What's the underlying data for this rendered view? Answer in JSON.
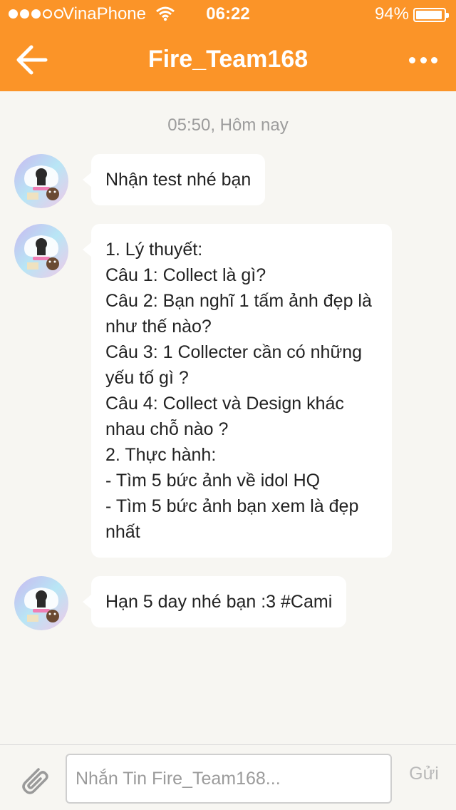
{
  "status_bar": {
    "signal_bars_filled": 3,
    "signal_bars_total": 5,
    "carrier": "VinaPhone",
    "time": "06:22",
    "battery_percent_label": "94%",
    "battery_level": 0.94
  },
  "header": {
    "title": "Fire_Team168",
    "back_icon": "arrow-left-icon",
    "more_icon": "more-dots-icon",
    "color": "#fb9428"
  },
  "chat": {
    "timestamp": "05:50, Hôm nay",
    "messages": [
      {
        "text": "Nhận test nhé bạn"
      },
      {
        "text": "1. Lý thuyết:\nCâu 1: Collect là gì?\nCâu 2: Bạn nghĩ 1 tấm ảnh đẹp là\nnhư thế nào?\nCâu 3: 1 Collecter cần có những\nyếu tố gì ?\nCâu 4: Collect và Design khác\nnhau chỗ nào ?\n2. Thực hành:\n- Tìm 5 bức ảnh về idol HQ\n- Tìm 5 bức ảnh bạn xem là đẹp\nnhất"
      },
      {
        "text": "Hạn 5 day nhé bạn :3 #Cami"
      }
    ]
  },
  "input_bar": {
    "attach_icon": "paperclip-icon",
    "placeholder": "Nhắn Tin Fire_Team168...",
    "value": "",
    "send_label": "Gửi"
  }
}
